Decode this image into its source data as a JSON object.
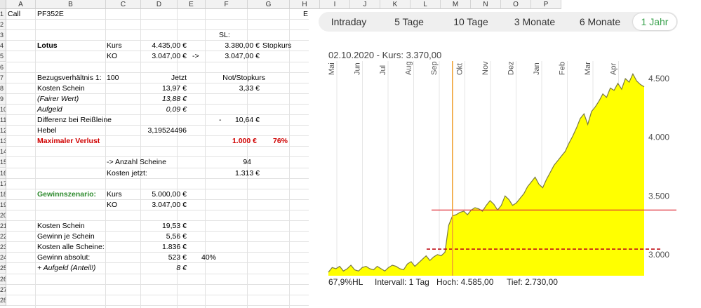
{
  "columns": [
    "A",
    "B",
    "C",
    "D",
    "E",
    "F",
    "G",
    "H",
    "I",
    "J",
    "K",
    "L",
    "M",
    "N",
    "O",
    "P"
  ],
  "rows": [
    "1",
    "2",
    "3",
    "4",
    "5",
    "6",
    "7",
    "8",
    "9",
    "10",
    "11",
    "12",
    "13",
    "14",
    "15",
    "16",
    "17",
    "18",
    "19",
    "20",
    "21",
    "22",
    "23",
    "24",
    "25",
    "26",
    "27",
    "28"
  ],
  "cells": {
    "a1": "Call",
    "b1": "PF352E",
    "g1_e": "E",
    "f3": "SL:",
    "b4": "Lotus",
    "c4": "Kurs",
    "d4": "4.435,00 €",
    "f4": "3.380,00 €",
    "g4": "Stopkurs",
    "c5": "KO",
    "d5": "3.047,00 €",
    "e5": "->",
    "f5": "3.047,00 €",
    "b7": "Bezugsverhältnis 1:",
    "c7": "100",
    "d7": "Jetzt",
    "f7": "Not/Stopkurs",
    "b8": "Kosten Schein",
    "d8": "13,97 €",
    "f8": "3,33 €",
    "b9": "(Fairer Wert)",
    "d9": "13,88 €",
    "b10": "Aufgeld",
    "d10": "0,09 €",
    "b11": "Differenz bei Reißleine",
    "f11a": "-",
    "f11b": "10,64 €",
    "b12": "Hebel",
    "d12": "3,19524496",
    "b13": "Maximaler Verlust",
    "f13": "1.000 €",
    "g13": "76%",
    "c15": "-> Anzahl Scheine",
    "f15": "94",
    "c16": "Kosten jetzt:",
    "f16": "1.313 €",
    "b18": "Gewinnszenario:",
    "c18": "Kurs",
    "d18": "5.000,00 €",
    "c19": "KO",
    "d19": "3.047,00 €",
    "b21": "Kosten Schein",
    "d21": "19,53 €",
    "b22": "Gewinn je Schein",
    "d22": "5,56 €",
    "b23": "Kosten alle Scheine:",
    "d23": "1.836 €",
    "b24": "Gewinn absolut:",
    "d24": "523 €",
    "e24": "40%",
    "b25": "+ Aufgeld (Anteil!)",
    "d25": "8 €"
  },
  "chart": {
    "tabs": [
      "Intraday",
      "5 Tage",
      "10 Tage",
      "3 Monate",
      "6 Monate",
      "1 Jahr"
    ],
    "active_tab": "1 Jahr",
    "crosshair_label": "02.10.2020  -  Kurs: 3.370,00",
    "stats": {
      "hl": "67,9%HL",
      "interval": "Intervall: 1 Tag",
      "hoch": "Hoch:  4.585,00",
      "tief": "Tief:  2.730,00"
    },
    "accent_color": "#3aa24e",
    "fill_color": "#ffff00",
    "line_color": "#7a7a40"
  },
  "chart_data": {
    "type": "area",
    "x_months": [
      "Mai",
      "Jun",
      "Jul",
      "Aug",
      "Sep",
      "Okt",
      "Nov",
      "Dez",
      "Jan",
      "Feb",
      "Mar",
      "Apr"
    ],
    "y_ticks": [
      "4.500",
      "4.000",
      "3.500",
      "3.000"
    ],
    "y_tick_values": [
      4500,
      4000,
      3500,
      3000
    ],
    "ylim": [
      2820,
      4650
    ],
    "values": [
      2850,
      2890,
      2880,
      2900,
      2860,
      2880,
      2910,
      2870,
      2860,
      2890,
      2900,
      2880,
      2870,
      2900,
      2880,
      2860,
      2890,
      2910,
      2900,
      2880,
      2870,
      2920,
      2940,
      2900,
      2930,
      2960,
      2990,
      2950,
      2980,
      3000,
      2990,
      3020,
      3250,
      3330,
      3340,
      3360,
      3370,
      3340,
      3380,
      3400,
      3390,
      3370,
      3420,
      3460,
      3430,
      3380,
      3420,
      3500,
      3470,
      3420,
      3440,
      3480,
      3520,
      3580,
      3620,
      3660,
      3600,
      3570,
      3640,
      3700,
      3760,
      3800,
      3840,
      3880,
      3950,
      4010,
      4080,
      4160,
      4200,
      4110,
      4220,
      4260,
      4310,
      4370,
      4340,
      4420,
      4400,
      4460,
      4410,
      4500,
      4470,
      4540,
      4480,
      4450,
      4430
    ],
    "stop_level": 3380,
    "ko_level": 3047,
    "crosshair_index": 33
  }
}
